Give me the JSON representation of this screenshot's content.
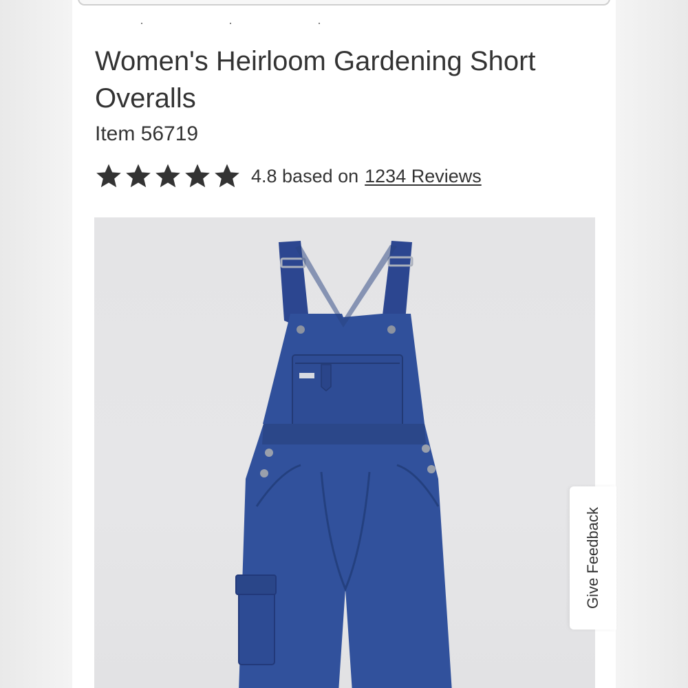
{
  "product": {
    "title": "Women's Heirloom Gardening Short Overalls",
    "item_number": "Item 56719",
    "rating": {
      "stars": 5,
      "text": "4.8 based on",
      "reviews_link": "1234 Reviews"
    },
    "color_swatch": "#2f4a93"
  },
  "feedback": {
    "label": "Give Feedback"
  },
  "icons": {
    "star": "star-icon"
  }
}
